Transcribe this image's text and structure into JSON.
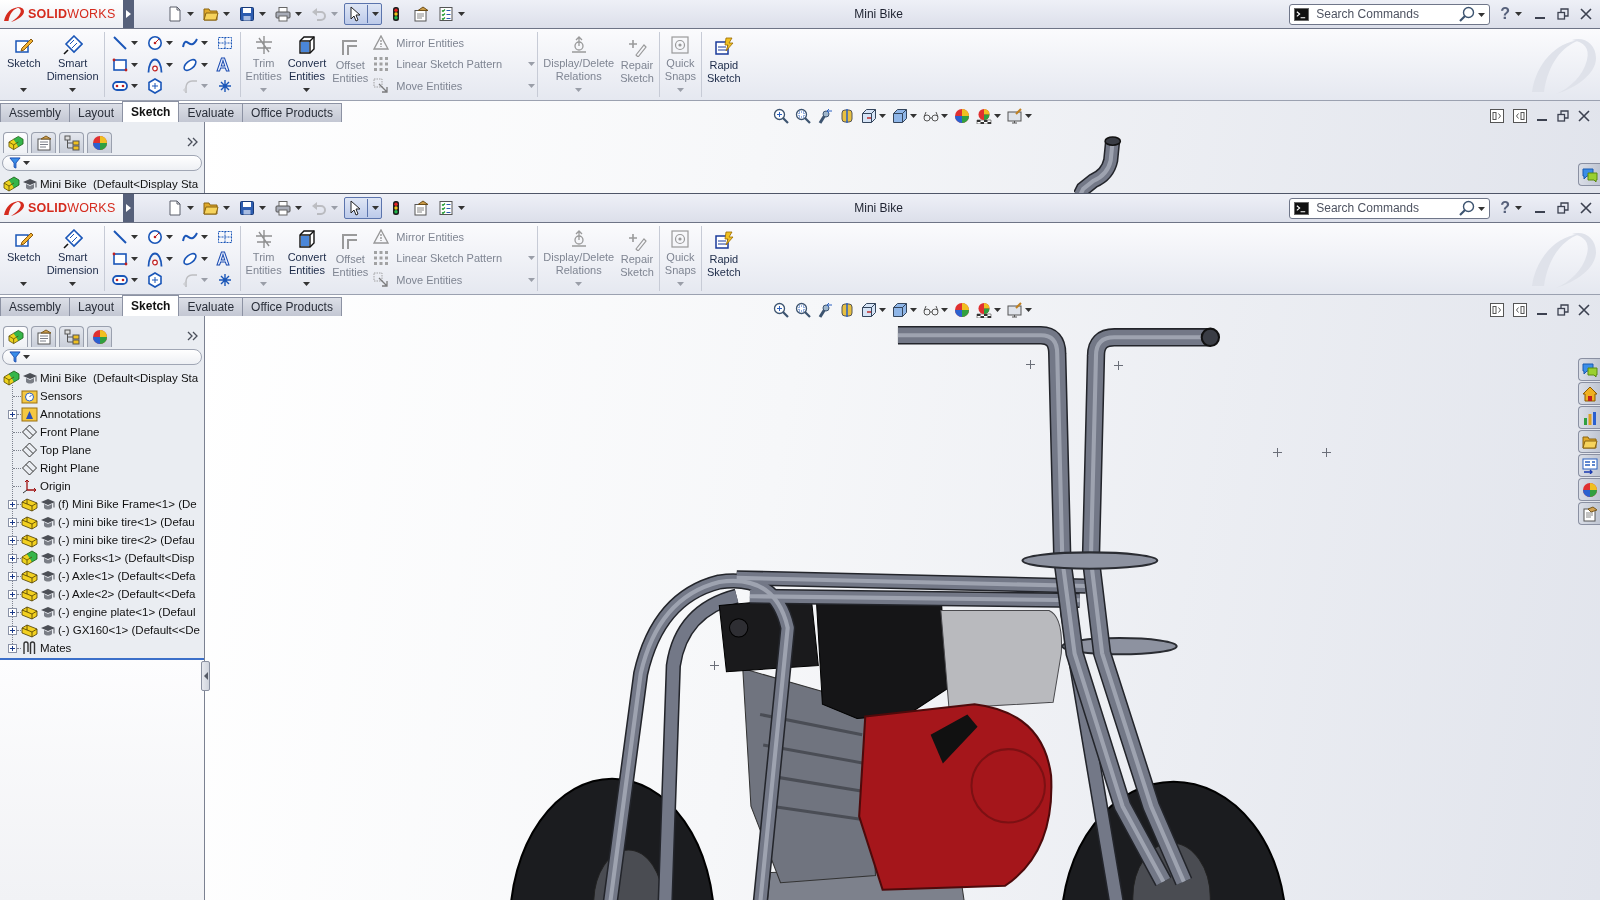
{
  "windows": [
    {
      "logo": "**SOLID**WORKS",
      "title": "Mini Bike",
      "search": {
        "placeholder": "Search Commands"
      },
      "help": "?",
      "quick_access": [
        {
          "dropdown": true,
          "disabled": false,
          "on": false
        },
        {
          "dropdown": true,
          "disabled": false,
          "on": false
        },
        {
          "dropdown": true,
          "disabled": false,
          "on": false
        },
        {
          "dropdown": true,
          "disabled": false,
          "on": false
        },
        {
          "dropdown": true,
          "disabled": true,
          "on": false
        },
        {
          "dropdown": true,
          "disabled": false,
          "on": true
        },
        {
          "dropdown": false,
          "disabled": false,
          "on": false
        },
        {
          "dropdown": false,
          "disabled": false,
          "on": false
        },
        {
          "dropdown": true,
          "disabled": false,
          "on": false
        }
      ],
      "ribbon": [
        {
          "items": [
            {
              "kind": "large",
              "label": "Sketch",
              "dropdown": true,
              "disabled": false
            },
            {
              "kind": "large",
              "label": "Smart Dimension",
              "dropdown": true,
              "disabled": false
            }
          ]
        },
        {
          "items": [
            {
              "kind": "grid",
              "tools": [
                {
                  "dropdown": true,
                  "disabled": false
                },
                {
                  "dropdown": true,
                  "disabled": false
                },
                {
                  "dropdown": true,
                  "disabled": false
                },
                {
                  "dropdown": false,
                  "disabled": false
                },
                {
                  "dropdown": true,
                  "disabled": false
                },
                {
                  "dropdown": true,
                  "disabled": false
                },
                {
                  "dropdown": true,
                  "disabled": false
                },
                {
                  "symbol": "A",
                  "dropdown": false,
                  "disabled": false
                },
                {
                  "dropdown": true,
                  "disabled": false
                },
                {
                  "dropdown": false,
                  "disabled": false
                },
                {
                  "dropdown": true,
                  "disabled": true
                },
                {
                  "dropdown": false,
                  "disabled": false
                }
              ]
            }
          ]
        },
        {
          "items": [
            {
              "kind": "large",
              "label": "Trim Entities",
              "dropdown": true,
              "disabled": true
            },
            {
              "kind": "large",
              "label": "Convert Entities",
              "dropdown": true,
              "disabled": false
            },
            {
              "kind": "large",
              "label": "Offset Entities",
              "dropdown": false,
              "disabled": true
            },
            {
              "kind": "stack",
              "rows": [
                {
                  "label": "Mirror Entities",
                  "dropdown": false,
                  "disabled": true
                },
                {
                  "label": "Linear Sketch Pattern",
                  "dropdown": true,
                  "disabled": true
                },
                {
                  "label": "Move Entities",
                  "dropdown": true,
                  "disabled": true
                }
              ]
            }
          ]
        },
        {
          "items": [
            {
              "kind": "large",
              "label": "Display/Delete Relations",
              "dropdown": true,
              "disabled": true
            },
            {
              "kind": "large",
              "label": "Repair Sketch",
              "dropdown": false,
              "disabled": true
            }
          ]
        },
        {
          "items": [
            {
              "kind": "large",
              "label": "Quick Snaps",
              "dropdown": true,
              "disabled": true
            }
          ]
        },
        {
          "items": [
            {
              "kind": "large",
              "label": "Rapid Sketch",
              "dropdown": false,
              "disabled": false
            }
          ]
        }
      ],
      "tabs": [
        {
          "label": "Assembly",
          "selected": false
        },
        {
          "label": "Layout",
          "selected": false
        },
        {
          "label": "Sketch",
          "selected": true
        },
        {
          "label": "Evaluate",
          "selected": false
        },
        {
          "label": "Office Products",
          "selected": false
        }
      ],
      "panel": {
        "tabs": [
          {
            "selected": true
          },
          {
            "selected": false
          },
          {
            "selected": false
          },
          {
            "selected": false
          }
        ],
        "tree": [
          {
            "label": "Mini Bike  (Default<Display Sta",
            "kind": "assembly"
          }
        ]
      }
    },
    {
      "logo": "**SOLID**WORKS",
      "title": "Mini Bike",
      "search": {
        "placeholder": "Search Commands"
      },
      "help": "?",
      "quick_access": [
        {
          "dropdown": true,
          "disabled": false,
          "on": false
        },
        {
          "dropdown": true,
          "disabled": false,
          "on": false
        },
        {
          "dropdown": true,
          "disabled": false,
          "on": false
        },
        {
          "dropdown": true,
          "disabled": false,
          "on": false
        },
        {
          "dropdown": true,
          "disabled": true,
          "on": false
        },
        {
          "dropdown": true,
          "disabled": false,
          "on": true
        },
        {
          "dropdown": false,
          "disabled": false,
          "on": false
        },
        {
          "dropdown": false,
          "disabled": false,
          "on": false
        },
        {
          "dropdown": true,
          "disabled": false,
          "on": false
        }
      ],
      "ribbon": [
        {
          "items": [
            {
              "kind": "large",
              "label": "Sketch",
              "dropdown": true,
              "disabled": false
            },
            {
              "kind": "large",
              "label": "Smart Dimension",
              "dropdown": true,
              "disabled": false
            }
          ]
        },
        {
          "items": [
            {
              "kind": "grid",
              "tools": [
                {
                  "dropdown": true,
                  "disabled": false
                },
                {
                  "dropdown": true,
                  "disabled": false
                },
                {
                  "dropdown": true,
                  "disabled": false
                },
                {
                  "dropdown": false,
                  "disabled": false
                },
                {
                  "dropdown": true,
                  "disabled": false
                },
                {
                  "dropdown": true,
                  "disabled": false
                },
                {
                  "dropdown": true,
                  "disabled": false
                },
                {
                  "symbol": "A",
                  "dropdown": false,
                  "disabled": false
                },
                {
                  "dropdown": true,
                  "disabled": false
                },
                {
                  "dropdown": false,
                  "disabled": false
                },
                {
                  "dropdown": true,
                  "disabled": true
                },
                {
                  "dropdown": false,
                  "disabled": false
                }
              ]
            }
          ]
        },
        {
          "items": [
            {
              "kind": "large",
              "label": "Trim Entities",
              "dropdown": true,
              "disabled": true
            },
            {
              "kind": "large",
              "label": "Convert Entities",
              "dropdown": true,
              "disabled": false
            },
            {
              "kind": "large",
              "label": "Offset Entities",
              "dropdown": false,
              "disabled": true
            },
            {
              "kind": "stack",
              "rows": [
                {
                  "label": "Mirror Entities",
                  "dropdown": false,
                  "disabled": true
                },
                {
                  "label": "Linear Sketch Pattern",
                  "dropdown": true,
                  "disabled": true
                },
                {
                  "label": "Move Entities",
                  "dropdown": true,
                  "disabled": true
                }
              ]
            }
          ]
        },
        {
          "items": [
            {
              "kind": "large",
              "label": "Display/Delete Relations",
              "dropdown": true,
              "disabled": true
            },
            {
              "kind": "large",
              "label": "Repair Sketch",
              "dropdown": false,
              "disabled": true
            }
          ]
        },
        {
          "items": [
            {
              "kind": "large",
              "label": "Quick Snaps",
              "dropdown": true,
              "disabled": true
            }
          ]
        },
        {
          "items": [
            {
              "kind": "large",
              "label": "Rapid Sketch",
              "dropdown": false,
              "disabled": false
            }
          ]
        }
      ],
      "tabs": [
        {
          "label": "Assembly",
          "selected": false
        },
        {
          "label": "Layout",
          "selected": false
        },
        {
          "label": "Sketch",
          "selected": true
        },
        {
          "label": "Evaluate",
          "selected": false
        },
        {
          "label": "Office Products",
          "selected": false
        }
      ],
      "panel": {
        "tabs": [
          {
            "selected": true
          },
          {
            "selected": false
          },
          {
            "selected": false
          },
          {
            "selected": false
          }
        ],
        "tree": [
          {
            "label": "Mini Bike  (Default<Display Sta",
            "kind": "assembly",
            "children": [
              {
                "label": "Sensors",
                "kind": "sensors",
                "expandable": false
              },
              {
                "label": "Annotations",
                "kind": "annotations",
                "expandable": true
              },
              {
                "label": "Front Plane",
                "kind": "plane",
                "expandable": false
              },
              {
                "label": "Top Plane",
                "kind": "plane",
                "expandable": false
              },
              {
                "label": "Right Plane",
                "kind": "plane",
                "expandable": false
              },
              {
                "label": "Origin",
                "kind": "origin",
                "expandable": false
              },
              {
                "label": "(f) Mini Bike Frame<1> (De",
                "kind": "part",
                "expandable": true
              },
              {
                "label": "(-) mini bike tire<1> (Defau",
                "kind": "part",
                "expandable": true
              },
              {
                "label": "(-) mini bike tire<2> (Defau",
                "kind": "part",
                "expandable": true
              },
              {
                "label": "(-) Forks<1> (Default<Disp",
                "kind": "subassembly",
                "expandable": true
              },
              {
                "label": "(-) Axle<1> (Default<<Defa",
                "kind": "part",
                "expandable": true
              },
              {
                "label": "(-) Axle<2> (Default<<Defa",
                "kind": "part",
                "expandable": true
              },
              {
                "label": "(-) engine plate<1> (Defaul",
                "kind": "part",
                "expandable": true
              },
              {
                "label": "(-) GX160<1> (Default<<De",
                "kind": "part",
                "expandable": true
              },
              {
                "label": "Mates",
                "kind": "mates",
                "expandable": true
              }
            ]
          }
        ]
      }
    }
  ]
}
